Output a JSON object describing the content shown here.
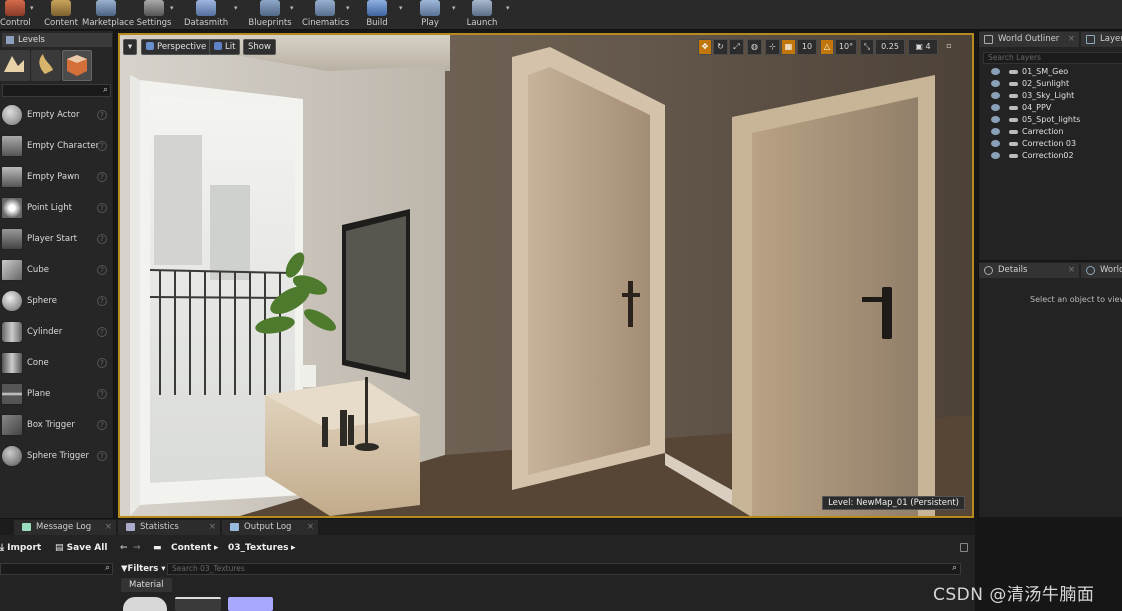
{
  "toolbar": {
    "items": [
      {
        "label": "Control",
        "icon": "build-control-icon"
      },
      {
        "label": "Content",
        "icon": "content-icon"
      },
      {
        "label": "Marketplace",
        "icon": "marketplace-icon"
      },
      {
        "label": "Settings",
        "icon": "settings-icon"
      },
      {
        "label": "Datasmith",
        "icon": "datasmith-icon"
      },
      {
        "label": "Blueprints",
        "icon": "blueprints-icon"
      },
      {
        "label": "Cinematics",
        "icon": "cinematics-icon"
      },
      {
        "label": "Build",
        "icon": "build-icon"
      },
      {
        "label": "Play",
        "icon": "play-icon"
      },
      {
        "label": "Launch",
        "icon": "launch-icon"
      }
    ]
  },
  "modes": {
    "levels_tab": "Levels",
    "place_items": [
      "Empty Actor",
      "Empty Character",
      "Empty Pawn",
      "Point Light",
      "Player Start",
      "Cube",
      "Sphere",
      "Cylinder",
      "Cone",
      "Plane",
      "Box Trigger",
      "Sphere Trigger"
    ]
  },
  "viewport": {
    "perspective": "Perspective",
    "lit": "Lit",
    "show": "Show",
    "grid_snap": "10",
    "rotation_snap": "10°",
    "scale_snap": "0.25",
    "camera_speed": "4",
    "level_label": "Level:  NewMap_01 (Persistent)"
  },
  "outliner": {
    "tab": "World Outliner",
    "layers_tab": "Layers",
    "search_placeholder": "Search Layers",
    "items": [
      "01_SM_Geo",
      "02_Sunlight",
      "03_Sky_Light",
      "04_PPV",
      "05_Spot_lights",
      "Carrection",
      "Correction 03",
      "Correction02"
    ]
  },
  "details": {
    "tab": "Details",
    "world_tab": "World",
    "hint": "Select an object to view de"
  },
  "bottom_tabs": [
    "Message Log",
    "Statistics",
    "Output Log"
  ],
  "content_browser": {
    "import": "Import",
    "save_all": "Save All",
    "path": [
      "Content",
      "03_Textures"
    ],
    "filters": "Filters",
    "search_placeholder": "Search 03_Textures",
    "filter_chip": "Material"
  },
  "watermark": "CSDN @清汤牛腩面"
}
